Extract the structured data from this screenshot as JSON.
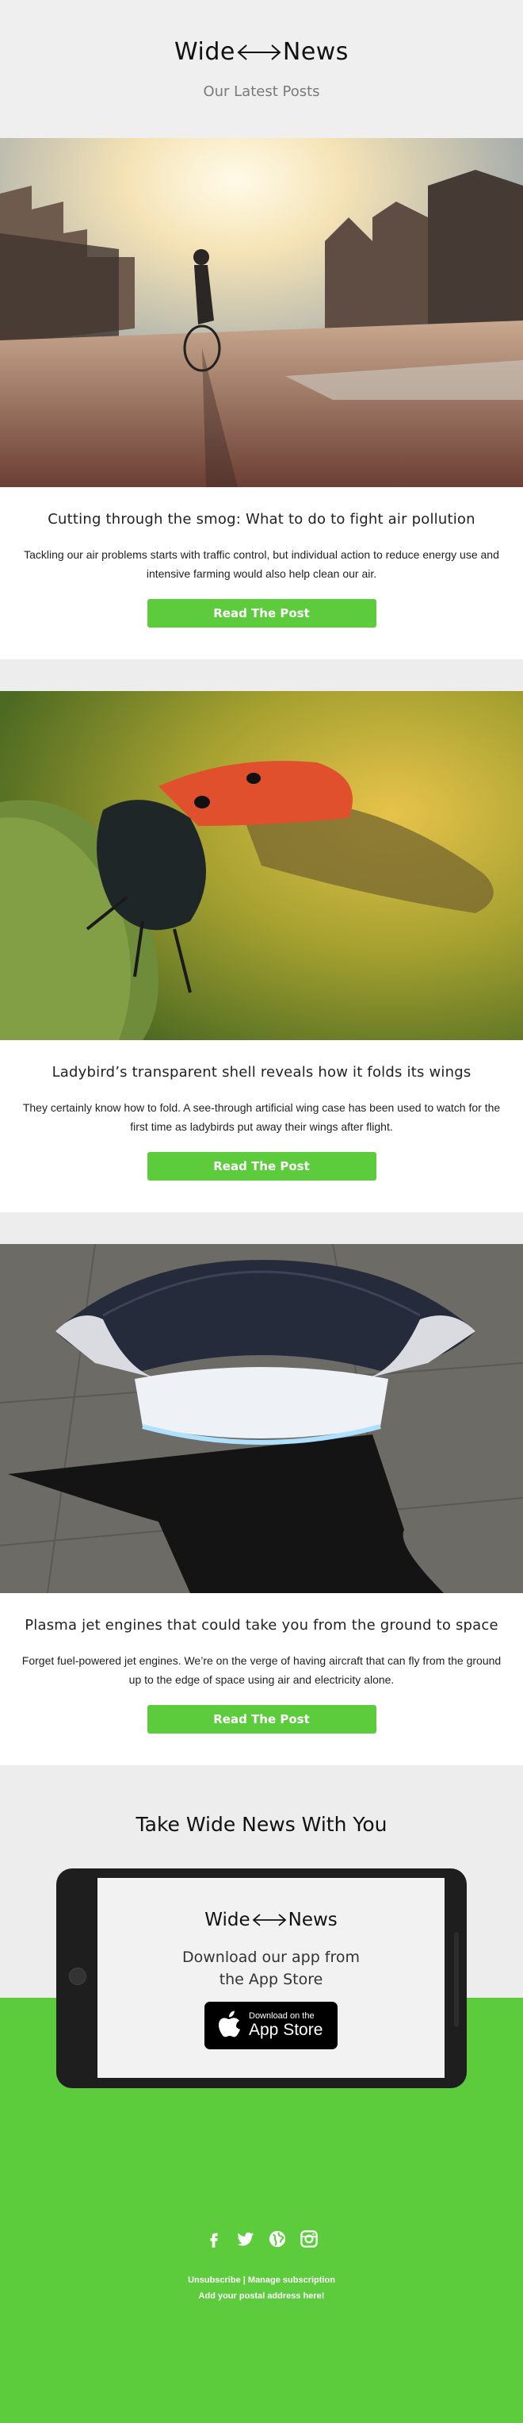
{
  "header": {
    "logo_left": "Wide",
    "logo_right": "News",
    "subtitle": "Our Latest Posts"
  },
  "posts": [
    {
      "title": "Cutting through the smog: What to do to fight air pollution",
      "text": "Tackling our air problems starts with traffic control, but individual action to reduce energy use and intensive farming would also help clean our air.",
      "button": "Read The Post"
    },
    {
      "title": "Ladybird’s transparent shell reveals how it folds its wings",
      "text": "They certainly know how to fold. A see-through artificial wing case has been used to watch for the first time as ladybirds put away their wings after flight.",
      "button": "Read The Post"
    },
    {
      "title": "Plasma jet engines that could take you from the ground to space",
      "text": "Forget fuel-powered jet engines. We’re on the verge of having aircraft that can fly from the ground up to the edge of space using air and electricity alone.",
      "button": "Read The Post"
    }
  ],
  "app": {
    "title": "Take Wide News With You",
    "logo_left": "Wide",
    "logo_right": "News",
    "desc_line1": "Download our app from",
    "desc_line2": "the App Store",
    "store_small": "Download on the",
    "store_big": "App Store"
  },
  "footer": {
    "social": [
      "facebook-icon",
      "twitter-icon",
      "globe-icon",
      "instagram-icon"
    ],
    "unsubscribe": "Unsubscribe",
    "separator": " | ",
    "manage": "Manage subscription",
    "address": "Add your postal address here!"
  },
  "colors": {
    "accent": "#5ccb3c",
    "background": "#ededed",
    "text": "#222222"
  }
}
